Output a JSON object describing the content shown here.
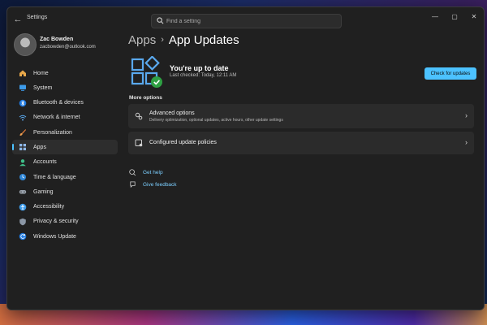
{
  "window": {
    "title": "Settings"
  },
  "search": {
    "placeholder": "Find a setting"
  },
  "window_controls": {
    "minimize": "—",
    "maximize": "▢",
    "close": "✕"
  },
  "profile": {
    "name": "Zac Bowden",
    "email": "zacbowden@outlook.com"
  },
  "nav": {
    "items": [
      {
        "label": "Home",
        "icon": "home-icon"
      },
      {
        "label": "System",
        "icon": "monitor-icon"
      },
      {
        "label": "Bluetooth & devices",
        "icon": "bluetooth-icon"
      },
      {
        "label": "Network & internet",
        "icon": "wifi-icon"
      },
      {
        "label": "Personalization",
        "icon": "brush-icon"
      },
      {
        "label": "Apps",
        "icon": "apps-icon",
        "active": true
      },
      {
        "label": "Accounts",
        "icon": "person-icon"
      },
      {
        "label": "Time & language",
        "icon": "globe-clock-icon"
      },
      {
        "label": "Gaming",
        "icon": "controller-icon"
      },
      {
        "label": "Accessibility",
        "icon": "accessibility-icon"
      },
      {
        "label": "Privacy & security",
        "icon": "shield-icon"
      },
      {
        "label": "Windows Update",
        "icon": "update-icon"
      }
    ]
  },
  "breadcrumb": {
    "parent": "Apps",
    "separator": "›",
    "current": "App Updates"
  },
  "status": {
    "title": "You're up to date",
    "subtitle": "Last checked: Today, 12:11 AM",
    "button": "Check for updates"
  },
  "more_options": {
    "label": "More options",
    "advanced": {
      "title": "Advanced options",
      "description": "Delivery optimization, optional updates, active hours, other update settings"
    },
    "policies": {
      "title": "Configured update policies"
    }
  },
  "links": {
    "help": "Get help",
    "feedback": "Give feedback"
  },
  "colors": {
    "accent": "#4cc2ff",
    "window_bg": "#202020",
    "card_bg": "#2b2b2b",
    "success": "#2ea043"
  }
}
